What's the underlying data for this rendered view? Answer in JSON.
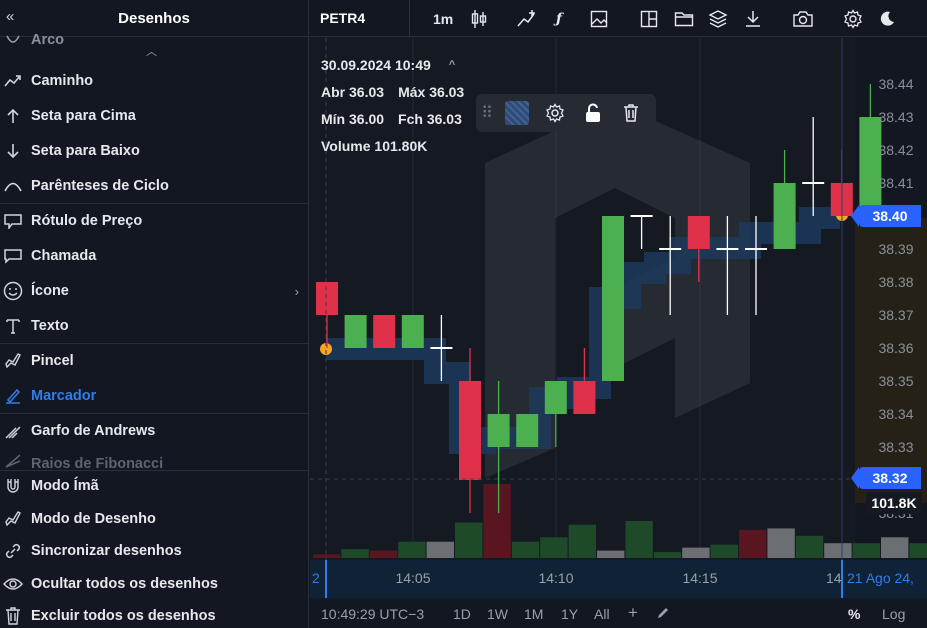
{
  "sidebar": {
    "back_icon": "double-chevron-left-icon",
    "title": "Desenhos",
    "items": [
      {
        "label": "Arco",
        "icon": "arc-icon"
      },
      {
        "label": "Caminho",
        "icon": "path-icon"
      },
      {
        "label": "Seta para Cima",
        "icon": "arrow-up-icon"
      },
      {
        "label": "Seta para Baixo",
        "icon": "arrow-down-icon"
      },
      {
        "label": "Parênteses de Ciclo",
        "icon": "cycle-bracket-icon"
      },
      {
        "label": "Rótulo de Preço",
        "icon": "price-label-icon"
      },
      {
        "label": "Chamada",
        "icon": "callout-icon"
      },
      {
        "label": "Ícone",
        "icon": "emoji-icon"
      },
      {
        "label": "Texto",
        "icon": "text-icon"
      },
      {
        "label": "Pincel",
        "icon": "brush-icon"
      },
      {
        "label": "Marcador",
        "icon": "highlighter-icon"
      },
      {
        "label": "Garfo de Andrews",
        "icon": "pitchfork-icon"
      },
      {
        "label": "Raios de Fibonacci",
        "icon": "fib-fan-icon"
      }
    ],
    "actions": [
      {
        "label": "Modo Ímã",
        "icon": "magnet-icon"
      },
      {
        "label": "Modo de Desenho",
        "icon": "draw-mode-icon"
      },
      {
        "label": "Sincronizar desenhos",
        "icon": "link-icon"
      },
      {
        "label": "Ocultar todos os desenhos",
        "icon": "eye-icon"
      },
      {
        "label": "Excluir todos os desenhos",
        "icon": "trash-icon"
      }
    ]
  },
  "toolbar": {
    "symbol": "PETR4",
    "interval": "1m",
    "buttons": [
      "candles-icon",
      "indicators-icon",
      "function-icon",
      "image-icon",
      "layout-icon",
      "folder-icon",
      "layers-icon",
      "download-icon",
      "camera-icon",
      "gear-icon",
      "moon-icon"
    ]
  },
  "legend": {
    "datetime": "30.09.2024 10:49",
    "open_label": "Abr",
    "open": "36.03",
    "high_label": "Máx",
    "high": "36.03",
    "low_label": "Mín",
    "low": "36.00",
    "close_label": "Fch",
    "close": "36.03",
    "volume_label": "Volume",
    "volume": "101.80K"
  },
  "floating_toolbar": {
    "icons": [
      "drag-handle-icon",
      "color-swatch-icon",
      "gear-icon",
      "unlock-icon",
      "trash-icon"
    ],
    "swatch_color": "#2d4b7c"
  },
  "price_axis": {
    "labels": [
      "38.44",
      "38.43",
      "38.42",
      "38.41",
      "38.40",
      "38.39",
      "38.38",
      "38.37",
      "38.36",
      "38.35",
      "38.34",
      "38.33",
      "38.32",
      "38.31"
    ],
    "last_price": "38.40",
    "crosshair_price": "38.32",
    "crosshair_volume": "101.8K"
  },
  "time_axis": {
    "labels": [
      "14:05",
      "14:10",
      "14:15"
    ],
    "crosshair_left": "2",
    "crosshair_right": "14",
    "crosshair_date": "21 Ago 24,"
  },
  "bottom_bar": {
    "clock": "10:49:29 UTC−3",
    "ranges": [
      "1D",
      "1W",
      "1M",
      "1Y",
      "All"
    ],
    "plus": "+",
    "percent": "%",
    "log": "Log"
  },
  "colors": {
    "up": "#4caf50",
    "down": "#e0314b",
    "highlight": "#1d3a5c",
    "accent": "#2962ff",
    "marker": "#f5a623",
    "background": "#151a22"
  },
  "chart_data": {
    "type": "candlestick",
    "ylim": [
      38.31,
      38.445
    ],
    "candles": [
      {
        "o": 38.38,
        "h": 38.38,
        "l": 38.36,
        "c": 38.37
      },
      {
        "o": 38.36,
        "h": 38.37,
        "l": 38.36,
        "c": 38.37
      },
      {
        "o": 38.37,
        "h": 38.37,
        "l": 38.36,
        "c": 38.36
      },
      {
        "o": 38.36,
        "h": 38.37,
        "l": 38.36,
        "c": 38.37
      },
      {
        "o": 38.36,
        "h": 38.37,
        "l": 38.35,
        "c": 38.36
      },
      {
        "o": 38.35,
        "h": 38.36,
        "l": 38.31,
        "c": 38.32
      },
      {
        "o": 38.33,
        "h": 38.35,
        "l": 38.31,
        "c": 38.34
      },
      {
        "o": 38.33,
        "h": 38.34,
        "l": 38.33,
        "c": 38.34
      },
      {
        "o": 38.34,
        "h": 38.35,
        "l": 38.33,
        "c": 38.35
      },
      {
        "o": 38.35,
        "h": 38.36,
        "l": 38.34,
        "c": 38.34
      },
      {
        "o": 38.35,
        "h": 38.4,
        "l": 38.35,
        "c": 38.4
      },
      {
        "o": 38.4,
        "h": 38.4,
        "l": 38.39,
        "c": 38.4
      },
      {
        "o": 38.39,
        "h": 38.4,
        "l": 38.37,
        "c": 38.39
      },
      {
        "o": 38.4,
        "h": 38.4,
        "l": 38.38,
        "c": 38.39
      },
      {
        "o": 38.39,
        "h": 38.4,
        "l": 38.37,
        "c": 38.39
      },
      {
        "o": 38.39,
        "h": 38.4,
        "l": 38.37,
        "c": 38.39
      },
      {
        "o": 38.39,
        "h": 38.42,
        "l": 38.39,
        "c": 38.41
      },
      {
        "o": 38.41,
        "h": 38.43,
        "l": 38.4,
        "c": 38.41
      },
      {
        "o": 38.41,
        "h": 38.42,
        "l": 38.4,
        "c": 38.4
      },
      {
        "o": 38.4,
        "h": 38.44,
        "l": 38.4,
        "c": 38.43
      }
    ],
    "volume": [
      5,
      12,
      10,
      22,
      22,
      48,
      100,
      22,
      28,
      45,
      10,
      50,
      8,
      14,
      18,
      38,
      40,
      30,
      20,
      20,
      28,
      20
    ],
    "volume_colors": [
      "down",
      "up",
      "down",
      "up",
      "gray",
      "up",
      "down",
      "up",
      "up",
      "up",
      "gray",
      "up",
      "up",
      "gray",
      "up",
      "down",
      "gray",
      "up",
      "gray",
      "up",
      "gray",
      "up"
    ]
  }
}
